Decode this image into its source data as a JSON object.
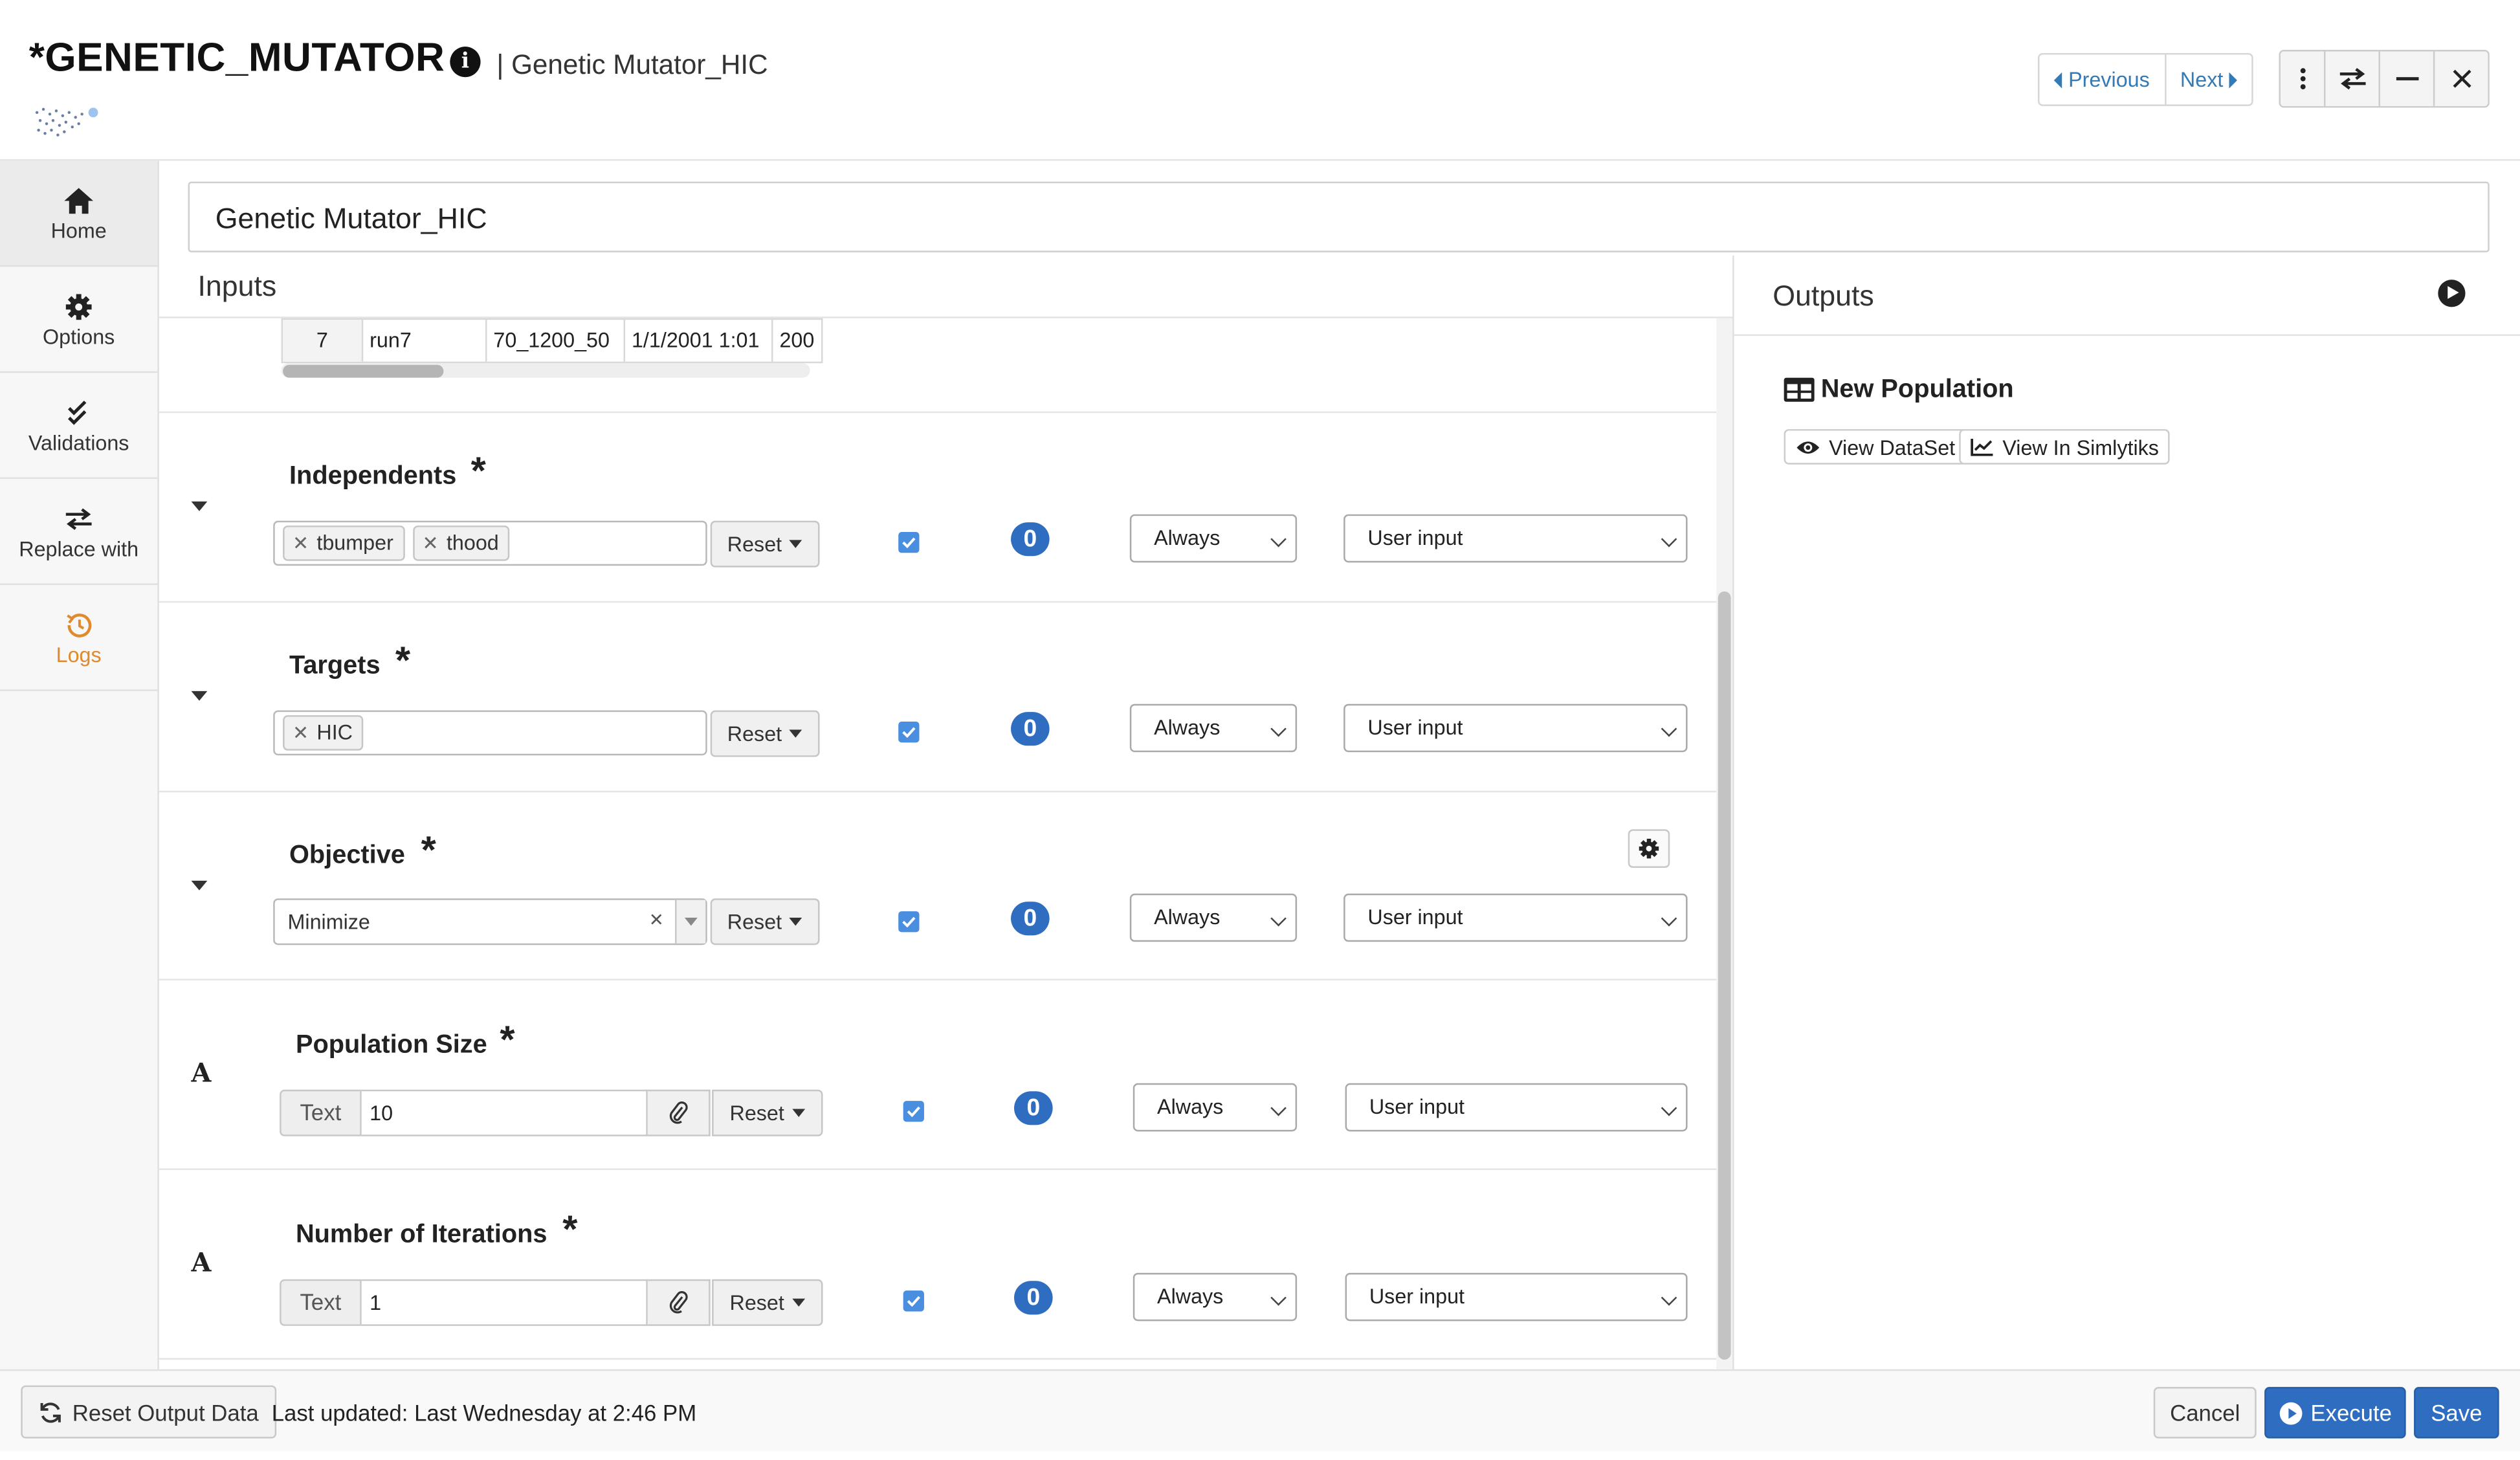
{
  "header": {
    "title": "*GENETIC_MUTATOR",
    "subtitle": "| Genetic Mutator_HIC",
    "nav": {
      "previous": "Previous",
      "next": "Next"
    }
  },
  "sidebar": {
    "items": [
      {
        "label": "Home",
        "icon": "home-icon"
      },
      {
        "label": "Options",
        "icon": "gear-icon"
      },
      {
        "label": "Validations",
        "icon": "check-icon"
      },
      {
        "label": "Replace with",
        "icon": "swap-icon"
      },
      {
        "label": "Logs",
        "icon": "history-icon",
        "color": "#e08a2e"
      }
    ]
  },
  "name_field": {
    "value": "Genetic Mutator_HIC"
  },
  "inputs": {
    "title": "Inputs",
    "preview_row": [
      "7",
      "run7",
      "70_1200_50",
      "1/1/2001 1:01",
      "200"
    ],
    "params": [
      {
        "label": "Independents",
        "required": "*",
        "tags": [
          "tbumper",
          "thood"
        ],
        "reset": "Reset",
        "count": "0",
        "frequency": "Always",
        "source": "User input"
      },
      {
        "label": "Targets",
        "required": "*",
        "tags": [
          "HIC"
        ],
        "reset": "Reset",
        "count": "0",
        "frequency": "Always",
        "source": "User input"
      },
      {
        "label": "Objective",
        "required": "*",
        "select_value": "Minimize",
        "reset": "Reset",
        "count": "0",
        "frequency": "Always",
        "source": "User input"
      },
      {
        "label": "Population Size",
        "required": "*",
        "type_icon": "A",
        "addon": "Text",
        "value": "10",
        "reset": "Reset",
        "count": "0",
        "frequency": "Always",
        "source": "User input"
      },
      {
        "label": "Number of Iterations",
        "required": "*",
        "type_icon": "A",
        "addon": "Text",
        "value": "1",
        "reset": "Reset",
        "count": "0",
        "frequency": "Always",
        "source": "User input"
      }
    ]
  },
  "outputs": {
    "title": "Outputs",
    "item": {
      "title": "New Population",
      "view_dataset": "View DataSet",
      "view_simlytiks": "View In Simlytiks"
    }
  },
  "footer": {
    "reset_output": "Reset Output Data",
    "last_updated": "Last updated: Last Wednesday at 2:46 PM",
    "cancel": "Cancel",
    "execute": "Execute",
    "save": "Save"
  },
  "colors": {
    "primary": "#2e6dbf",
    "link": "#337ab7",
    "logs": "#e08a2e",
    "checkbox": "#4a8ee0"
  }
}
